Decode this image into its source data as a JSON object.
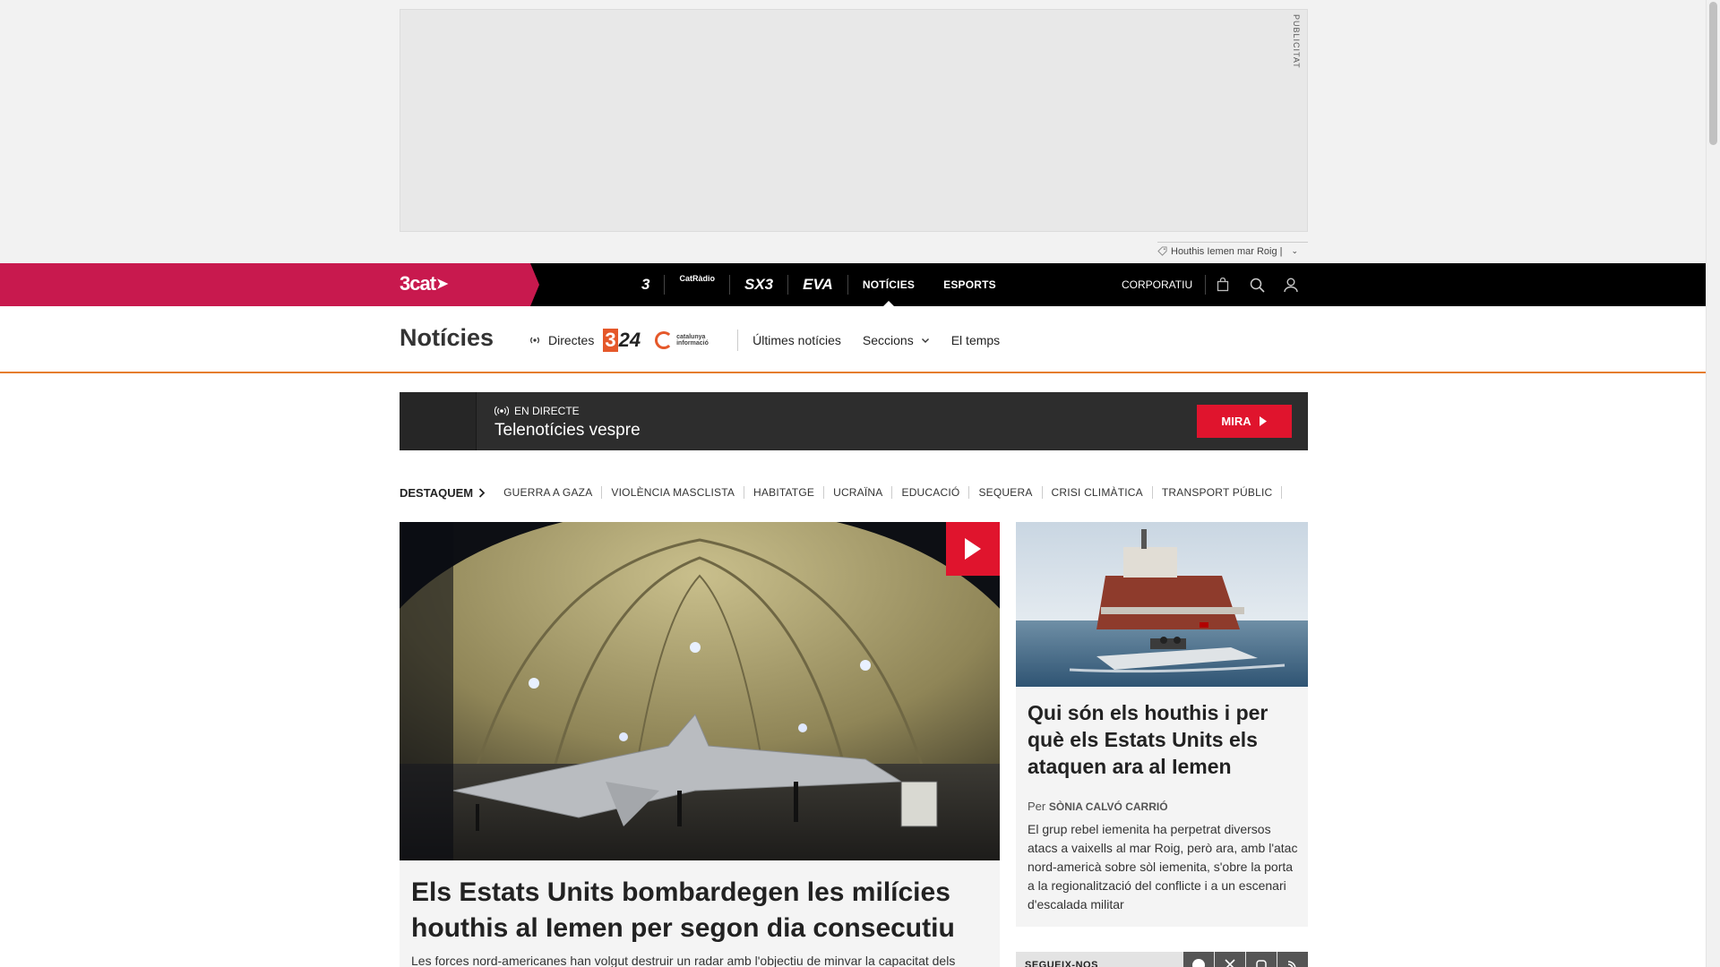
{
  "ad": {
    "label": "PUBLICITAT",
    "tag": "Houthis Iemen mar Roig |"
  },
  "topnav": {
    "brand": "3cat",
    "channels": [
      {
        "label": "3",
        "icon": "tv3-logo"
      },
      {
        "label": "CatRàdio",
        "icon": "catradio-logo"
      },
      {
        "label": "SX3",
        "icon": "sx3-logo"
      },
      {
        "label": "EVA",
        "icon": "eva-logo"
      }
    ],
    "noticies": "NOTÍCIES",
    "esports": "ESPORTS",
    "corporatiu": "CORPORATIU"
  },
  "secnav": {
    "title": "Notícies",
    "directes": "Directes",
    "logo_324": "24",
    "logo_324_prefix": "3",
    "logo_ci": "catalunya informació",
    "ultimes": "Últimes notícies",
    "seccions": "Seccions",
    "temps": "El temps"
  },
  "live": {
    "label": "EN DIRECTE",
    "program": "Telenotícies vespre",
    "cta": "MIRA"
  },
  "destaquem": {
    "lead": "DESTAQUEM",
    "tags": [
      "GUERRA A GAZA",
      "VIOLÈNCIA MASCLISTA",
      "HABITATGE",
      "UCRAÏNA",
      "EDUCACIÓ",
      "SEQUERA",
      "CRISI CLIMÀTICA",
      "TRANSPORT PÚBLIC"
    ]
  },
  "main_article": {
    "title": "Els Estats Units bombardegen les milícies houthis al Iemen per segon dia consecutiu",
    "lede": "Les forces nord-americanes han volgut destruir un radar amb l'objectiu de minvar la capacitat dels"
  },
  "side_article": {
    "title": "Qui són els houthis i per què els Estats Units els ataquen ara al Iemen",
    "by": "Per",
    "author": "Sònia Calvó Carrió",
    "lede": "El grup rebel iemenita ha perpetrat diversos atacs a vaixells al mar Roig, però ara, amb l'atac nord-americà sobre sòl iemenita, s'obre la porta a la regionalització del conflicte i a un escenari d'escalada militar"
  },
  "follow": {
    "label": "SEGUEIX-NOS",
    "socials": [
      "facebook-icon",
      "x-icon",
      "instagram-icon",
      "rss-icon"
    ]
  },
  "colors": {
    "brand": "#c8194e",
    "accent_red": "#e0142d",
    "section_line": "#e57d2e"
  }
}
